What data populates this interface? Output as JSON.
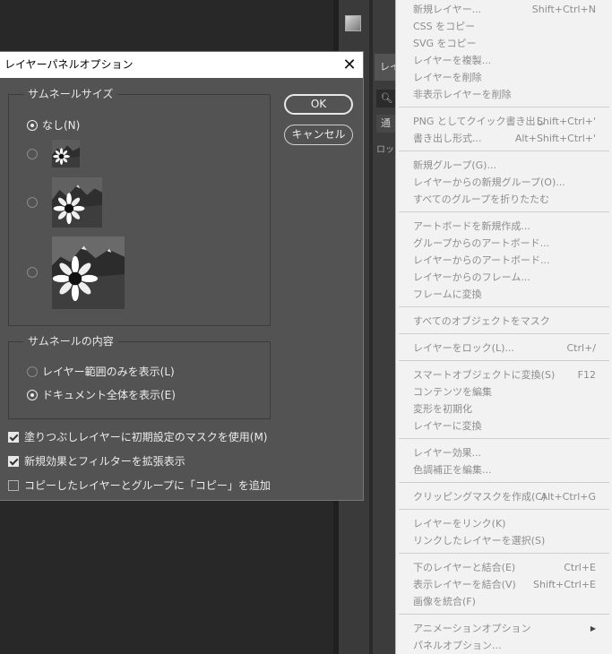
{
  "dialog": {
    "title": "レイヤーパネルオプション",
    "thumbnail_size": {
      "legend": "サムネールサイズ",
      "options": [
        {
          "label": "なし(N)",
          "checked": true
        },
        {
          "label": "",
          "checked": false
        },
        {
          "label": "",
          "checked": false
        },
        {
          "label": "",
          "checked": false
        }
      ]
    },
    "thumbnail_content": {
      "legend": "サムネールの内容",
      "options": [
        {
          "label": "レイヤー範囲のみを表示(L)",
          "checked": false
        },
        {
          "label": "ドキュメント全体を表示(E)",
          "checked": true
        }
      ]
    },
    "checkboxes": [
      {
        "label": "塗りつぶしレイヤーに初期設定のマスクを使用(M)",
        "checked": true
      },
      {
        "label": "新規効果とフィルターを拡張表示",
        "checked": true
      },
      {
        "label": "コピーしたレイヤーとグループに「コピー」を追加",
        "checked": false
      }
    ],
    "ok_label": "OK",
    "cancel_label": "キャンセル"
  },
  "layers_panel": {
    "tab_label": "レイ",
    "blend_label": "通",
    "lock_label": "ロック"
  },
  "context_menu": {
    "groups": [
      [
        {
          "label": "新規レイヤー...",
          "shortcut": "Shift+Ctrl+N"
        },
        {
          "label": "CSS をコピー",
          "shortcut": ""
        },
        {
          "label": "SVG をコピー",
          "shortcut": ""
        },
        {
          "label": "レイヤーを複製...",
          "shortcut": ""
        },
        {
          "label": "レイヤーを削除",
          "shortcut": ""
        },
        {
          "label": "非表示レイヤーを削除",
          "shortcut": ""
        }
      ],
      [
        {
          "label": "PNG としてクイック書き出し",
          "shortcut": "Shift+Ctrl+'"
        },
        {
          "label": "書き出し形式...",
          "shortcut": "Alt+Shift+Ctrl+'"
        }
      ],
      [
        {
          "label": "新規グループ(G)...",
          "shortcut": ""
        },
        {
          "label": "レイヤーからの新規グループ(O)...",
          "shortcut": ""
        },
        {
          "label": "すべてのグループを折りたたむ",
          "shortcut": ""
        }
      ],
      [
        {
          "label": "アートボードを新規作成...",
          "shortcut": ""
        },
        {
          "label": "グループからのアートボード...",
          "shortcut": ""
        },
        {
          "label": "レイヤーからのアートボード...",
          "shortcut": ""
        },
        {
          "label": "レイヤーからのフレーム...",
          "shortcut": ""
        },
        {
          "label": "フレームに変換",
          "shortcut": ""
        }
      ],
      [
        {
          "label": "すべてのオブジェクトをマスク",
          "shortcut": ""
        }
      ],
      [
        {
          "label": "レイヤーをロック(L)...",
          "shortcut": "Ctrl+/"
        }
      ],
      [
        {
          "label": "スマートオブジェクトに変換(S)",
          "shortcut": "F12"
        },
        {
          "label": "コンテンツを編集",
          "shortcut": ""
        },
        {
          "label": "変形を初期化",
          "shortcut": ""
        },
        {
          "label": "レイヤーに変換",
          "shortcut": ""
        }
      ],
      [
        {
          "label": "レイヤー効果...",
          "shortcut": ""
        },
        {
          "label": "色調補正を編集...",
          "shortcut": ""
        }
      ],
      [
        {
          "label": "クリッピングマスクを作成(C)",
          "shortcut": "Alt+Ctrl+G"
        }
      ],
      [
        {
          "label": "レイヤーをリンク(K)",
          "shortcut": ""
        },
        {
          "label": "リンクしたレイヤーを選択(S)",
          "shortcut": ""
        }
      ],
      [
        {
          "label": "下のレイヤーと結合(E)",
          "shortcut": "Ctrl+E"
        },
        {
          "label": "表示レイヤーを結合(V)",
          "shortcut": "Shift+Ctrl+E"
        },
        {
          "label": "画像を統合(F)",
          "shortcut": ""
        }
      ],
      [
        {
          "label": "アニメーションオプション",
          "shortcut": "",
          "submenu": true
        },
        {
          "label": "パネルオプション...",
          "shortcut": ""
        }
      ]
    ]
  }
}
